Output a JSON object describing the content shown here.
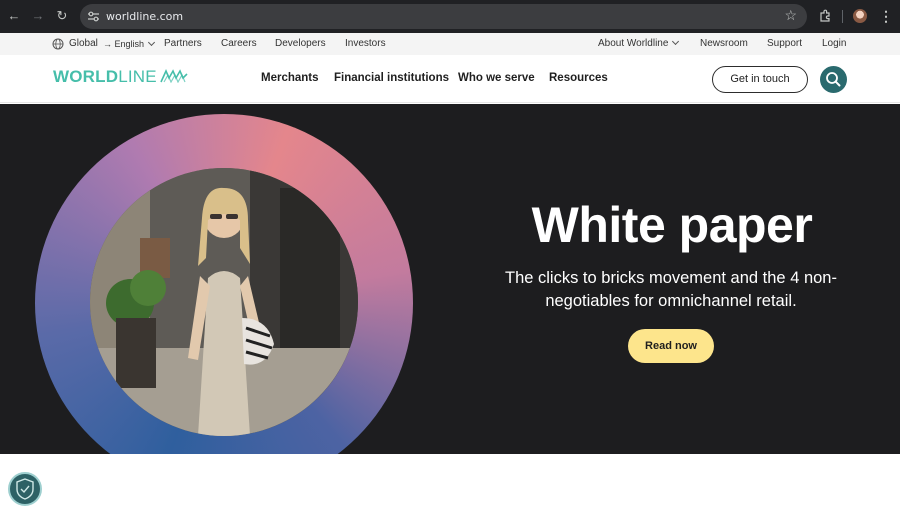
{
  "browser": {
    "url": "worldline.com",
    "icons": [
      "back-icon",
      "forward-icon",
      "reload-icon",
      "site-settings-icon",
      "star-icon",
      "extensions-icon",
      "profile-avatar",
      "kebab-menu-icon"
    ]
  },
  "utility_bar": {
    "region": "Global",
    "language": "→ English",
    "left_links": [
      "Partners",
      "Careers",
      "Developers",
      "Investors"
    ],
    "about": "About Worldline",
    "right_links": [
      "Newsroom",
      "Support",
      "Login"
    ]
  },
  "nav": {
    "logo_bold": "WORLD",
    "logo_thin": "LINE",
    "items": [
      "Merchants",
      "Financial institutions",
      "Who we serve",
      "Resources"
    ],
    "cta": "Get in touch"
  },
  "hero": {
    "title": "White paper",
    "subtitle": "The clicks to bricks movement and the 4 non-negotiables for omnichannel retail.",
    "button": "Read now"
  },
  "colors": {
    "brand_teal": "#46beaa",
    "search_button": "#2a6a6e",
    "hero_bg": "#1d1d1f",
    "cta_yellow": "#fde58c"
  }
}
